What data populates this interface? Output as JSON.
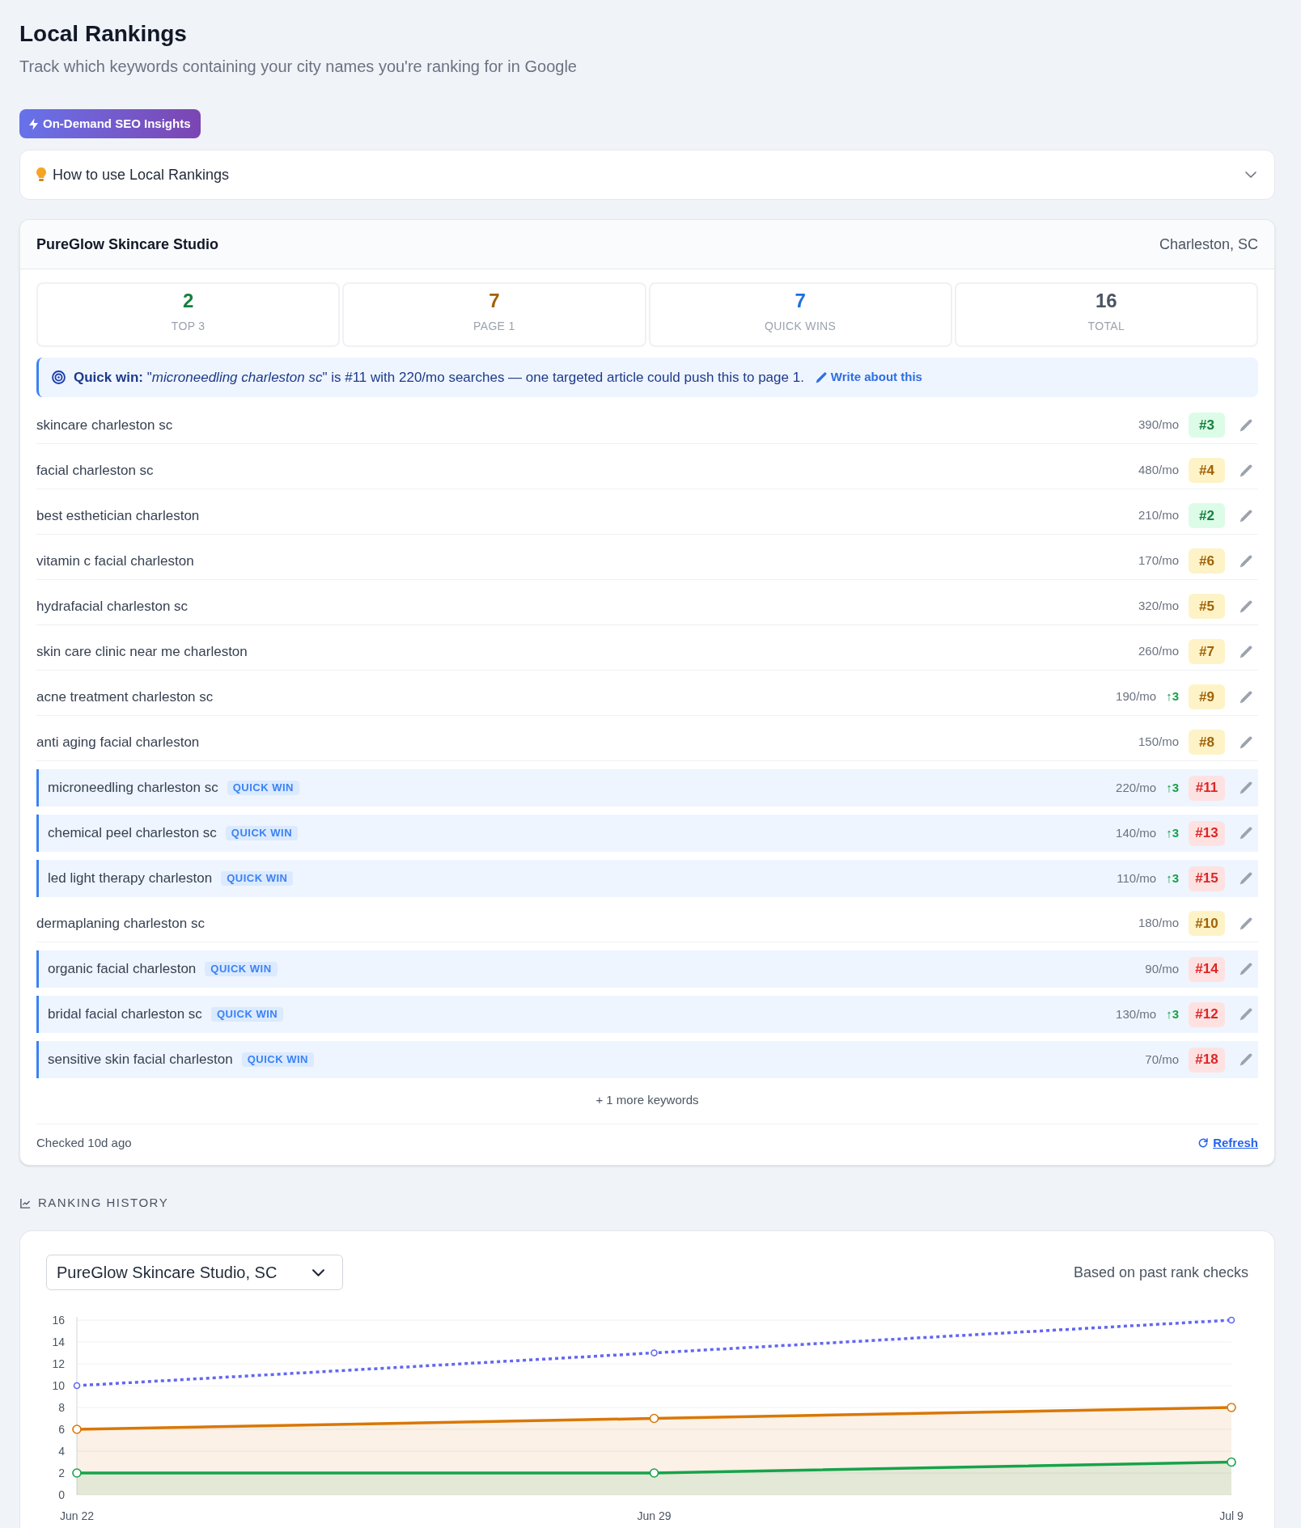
{
  "header": {
    "title": "Local Rankings",
    "subtitle": "Track which keywords containing your city names you're ranking for in Google"
  },
  "insights_button": {
    "label": "On-Demand SEO Insights"
  },
  "help_panel": {
    "title": "How to use Local Rankings",
    "expanded": false
  },
  "business_card": {
    "name": "PureGlow Skincare Studio",
    "location": "Charleston, SC",
    "stats": [
      {
        "value": "2",
        "label": "TOP 3",
        "color": "#15803d"
      },
      {
        "value": "7",
        "label": "PAGE 1",
        "color": "#a16207"
      },
      {
        "value": "7",
        "label": "QUICK WINS",
        "color": "#1d6fe0"
      },
      {
        "value": "16",
        "label": "TOTAL",
        "color": "#4b5563"
      }
    ],
    "tip": {
      "message": "**Quick win:** \"*microneedling charleston sc*\" is #11 with 220/mo searches — one targeted article could push this to page 1.",
      "link": "Write about this"
    },
    "keywords": [
      {
        "keyword": "skincare charleston sc",
        "quick_win": false,
        "volume": "390/mo",
        "rank": "#3",
        "kind": "top"
      },
      {
        "keyword": "facial charleston sc",
        "quick_win": false,
        "volume": "480/mo",
        "rank": "#4",
        "kind": "first"
      },
      {
        "keyword": "best esthetician charleston",
        "quick_win": false,
        "volume": "210/mo",
        "rank": "#2",
        "kind": "top"
      },
      {
        "keyword": "vitamin c facial charleston",
        "quick_win": false,
        "volume": "170/mo",
        "rank": "#6",
        "kind": "first"
      },
      {
        "keyword": "hydrafacial charleston sc",
        "quick_win": false,
        "volume": "320/mo",
        "rank": "#5",
        "kind": "first"
      },
      {
        "keyword": "skin care clinic near me charleston",
        "quick_win": false,
        "volume": "260/mo",
        "rank": "#7",
        "kind": "first"
      },
      {
        "keyword": "acne treatment charleston sc",
        "quick_win": false,
        "volume": "190/mo",
        "change": "↑3",
        "rank": "#9",
        "kind": "first"
      },
      {
        "keyword": "anti aging facial charleston",
        "quick_win": false,
        "volume": "150/mo",
        "rank": "#8",
        "kind": "first"
      },
      {
        "keyword": "microneedling charleston sc",
        "quick_win": true,
        "badge": "QUICK WIN",
        "volume": "220/mo",
        "change": "↑3",
        "rank": "#11",
        "kind": "beyond"
      },
      {
        "keyword": "chemical peel charleston sc",
        "quick_win": true,
        "badge": "QUICK WIN",
        "volume": "140/mo",
        "change": "↑3",
        "rank": "#13",
        "kind": "beyond"
      },
      {
        "keyword": "led light therapy charleston",
        "quick_win": true,
        "badge": "QUICK WIN",
        "volume": "110/mo",
        "change": "↑3",
        "rank": "#15",
        "kind": "beyond"
      },
      {
        "keyword": "dermaplaning charleston sc",
        "quick_win": false,
        "volume": "180/mo",
        "rank": "#10",
        "kind": "first"
      },
      {
        "keyword": "organic facial charleston",
        "quick_win": true,
        "badge": "QUICK WIN",
        "volume": "90/mo",
        "rank": "#14",
        "kind": "beyond"
      },
      {
        "keyword": "bridal facial charleston sc",
        "quick_win": true,
        "badge": "QUICK WIN",
        "volume": "130/mo",
        "change": "↑3",
        "rank": "#12",
        "kind": "beyond"
      },
      {
        "keyword": "sensitive skin facial charleston",
        "quick_win": true,
        "badge": "QUICK WIN",
        "volume": "70/mo",
        "rank": "#18",
        "kind": "beyond"
      }
    ],
    "more": "+ 1 more keywords",
    "checked": "Checked 10d ago",
    "refresh": "Refresh"
  },
  "history": {
    "heading": "RANKING HISTORY",
    "select": {
      "value": "PureGlow Skincare Studio, SC"
    },
    "note": "Based on past rank checks",
    "chart_data": {
      "type": "line",
      "categories": [
        "Jun 22",
        "Jun 29",
        "Jul 9"
      ],
      "series": [
        {
          "type": "line",
          "color": "#6366f1",
          "line_style": "dotted",
          "marker": "circle",
          "values": [
            10,
            13,
            16
          ]
        },
        {
          "type": "area",
          "color": "#d97706",
          "line_style": "solid",
          "marker": "circle",
          "values": [
            6,
            7,
            8
          ]
        },
        {
          "type": "area",
          "color": "#16a34a",
          "line_style": "solid",
          "marker": "circle",
          "values": [
            2,
            2,
            3
          ]
        }
      ],
      "ylim": [
        0,
        16
      ],
      "yticks": [
        {
          "value": 0,
          "label": "0"
        },
        {
          "value": 2,
          "label": "2"
        },
        {
          "value": 4,
          "label": "4"
        },
        {
          "value": 6,
          "label": "6"
        },
        {
          "value": 8,
          "label": "8"
        },
        {
          "value": 10,
          "label": "10"
        },
        {
          "value": 12,
          "label": "12"
        },
        {
          "value": 14,
          "label": "14"
        },
        {
          "value": 16,
          "label": "16"
        }
      ],
      "grid": true
    }
  }
}
